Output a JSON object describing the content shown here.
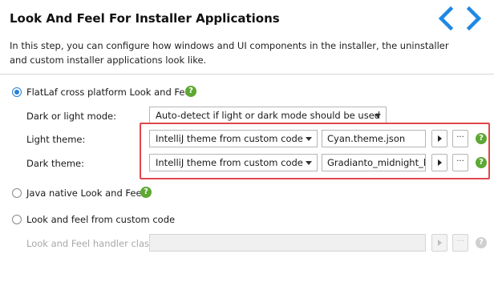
{
  "header": {
    "title": "Look And Feel For Installer Applications",
    "description": "In this step, you can configure how windows and UI components in the installer, the uninstaller and custom installer applications look like.",
    "nav_back_icon": "chevron-left-icon",
    "nav_forward_icon": "chevron-right-icon",
    "accent_color": "#1e88e5"
  },
  "options": {
    "flatlaf": {
      "label": "FlatLaf cross platform Look and Feel",
      "selected": true,
      "mode_label": "Dark or light mode:",
      "mode_value": "Auto-detect if light or dark mode should be used",
      "light_label": "Light theme:",
      "light_source": "IntelliJ theme from custom code",
      "light_file": "Cyan.theme.json",
      "dark_label": "Dark theme:",
      "dark_source": "IntelliJ theme from custom code",
      "dark_file": "Gradianto_midnight_b"
    },
    "native": {
      "label": "Java native Look and Feel",
      "selected": false
    },
    "custom": {
      "label": "Look and feel from custom code",
      "selected": false,
      "handler_label": "Look and Feel handler class:",
      "handler_value": ""
    }
  },
  "buttons": {
    "more_label": "···",
    "help_label": "?"
  },
  "colors": {
    "help_green": "#5da832",
    "radio_blue": "#2a7fd4",
    "highlight_red": "#e0474c"
  }
}
